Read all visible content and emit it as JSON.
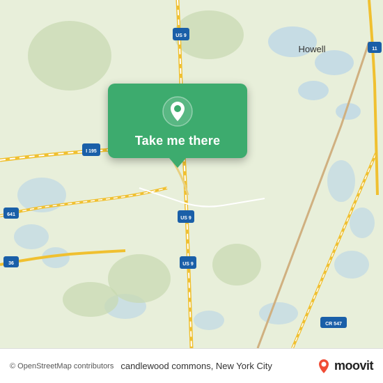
{
  "map": {
    "bg_color": "#e8efda",
    "attribution": "© OpenStreetMap contributors",
    "location_label": "candlewood commons, New York City"
  },
  "popup": {
    "label": "Take me there"
  },
  "moovit": {
    "text": "moovit"
  },
  "labels": {
    "us9_north": "US 9",
    "us9_south": "US 9",
    "i195": "I 195",
    "rt641": "641",
    "rt36": "36",
    "howell": "Howell",
    "cr547": "CR 547",
    "rt11": "11"
  }
}
